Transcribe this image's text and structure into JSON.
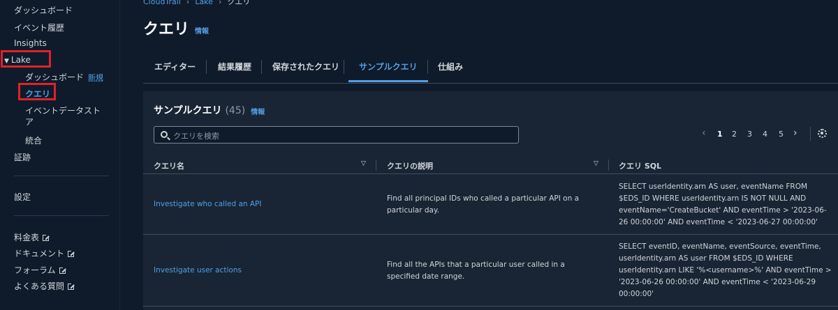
{
  "sidebar": {
    "items": [
      {
        "label": "ダッシュボード"
      },
      {
        "label": "イベント履歴"
      },
      {
        "label": "Insights"
      },
      {
        "label": "Lake"
      },
      {
        "label": "ダッシュボード",
        "badge": "新規"
      },
      {
        "label": "クエリ"
      },
      {
        "label": "イベントデータストア"
      },
      {
        "label": "統合"
      },
      {
        "label": "証跡"
      },
      {
        "label": "設定"
      },
      {
        "label": "料金表"
      },
      {
        "label": "ドキュメント"
      },
      {
        "label": "フォーラム"
      },
      {
        "label": "よくある質問"
      }
    ],
    "expand_icon": "caret-down-icon",
    "external_icon": "external-link-icon"
  },
  "breadcrumb": [
    "CloudTrail",
    "Lake",
    "クエリ"
  ],
  "page": {
    "title": "クエリ",
    "info": "情報"
  },
  "tabs": [
    "エディター",
    "結果履歴",
    "保存されたクエリ",
    "サンプルクエリ",
    "仕組み"
  ],
  "active_tab": "サンプルクエリ",
  "panel": {
    "title": "サンプルクエリ",
    "count": "(45)",
    "info": "情報",
    "search_placeholder": "クエリを検索",
    "pages": [
      "1",
      "2",
      "3",
      "4",
      "5"
    ],
    "current_page": "1"
  },
  "table": {
    "columns": [
      "クエリ名",
      "クエリの説明",
      "クエリ SQL"
    ],
    "rows": [
      {
        "name": "Investigate who called an API",
        "description": "Find all principal IDs who called a particular API on a particular day.",
        "sql": "SELECT userIdentity.arn AS user, eventName FROM $EDS_ID WHERE userIdentity.arn IS NOT NULL AND eventName='CreateBucket' AND eventTime > '2023-06-26 00:00:00' AND eventTime < '2023-06-27 00:00:00'"
      },
      {
        "name": "Investigate user actions",
        "description": "Find all the APIs that a particular user called in a specified date range.",
        "sql": "SELECT eventID, eventName, eventSource, eventTime, userIdentity.arn AS user FROM $EDS_ID WHERE userIdentity.arn LIKE '%<username>%' AND eventTime > '2023-06-26 00:00:00' AND eventTime < '2023-06-29 00:00:00'"
      }
    ]
  },
  "colors": {
    "accent": "#539fe5",
    "background": "#0f1b2a",
    "panel": "#192534",
    "highlight": "#e0222a"
  }
}
